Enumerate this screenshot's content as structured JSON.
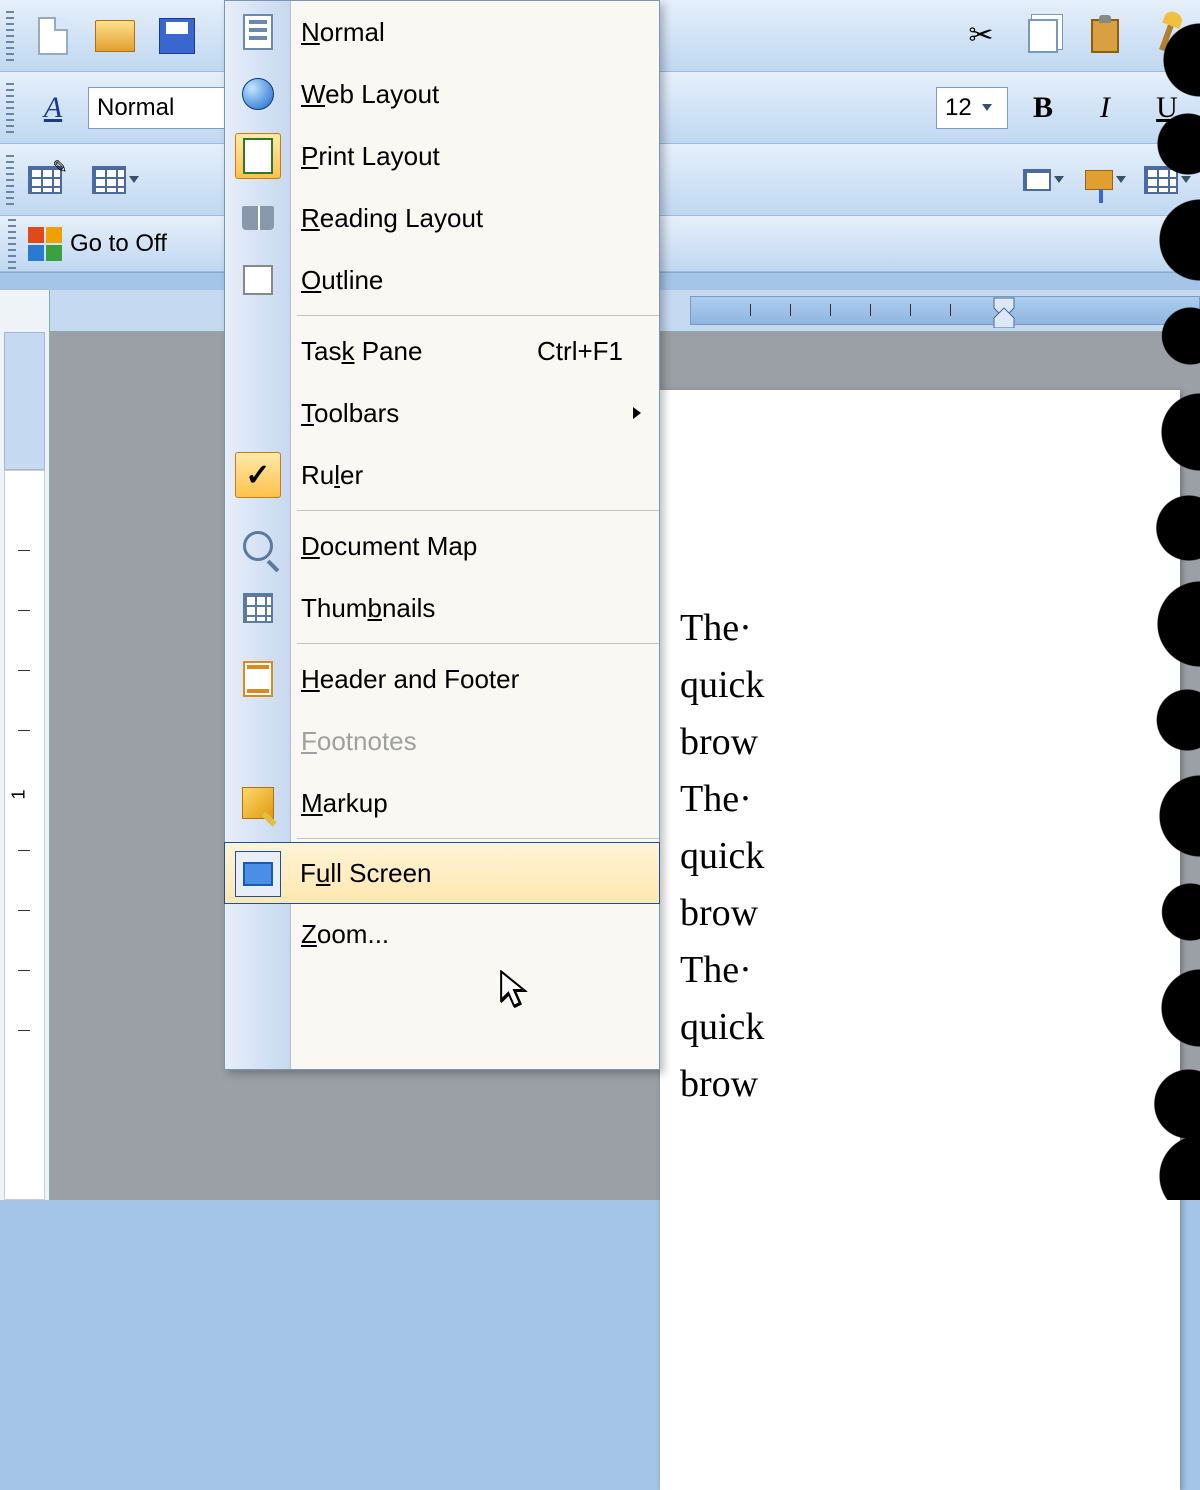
{
  "toolbar": {
    "style_combo": "Normal",
    "font_size": "12",
    "bold": "B",
    "italic": "I",
    "underline": "U",
    "office_link": "Go to Off"
  },
  "menu": {
    "normal": "Normal",
    "web_layout": "Web Layout",
    "print_layout": "Print Layout",
    "reading_layout": "Reading Layout",
    "outline": "Outline",
    "task_pane": "Task Pane",
    "task_pane_shortcut": "Ctrl+F1",
    "toolbars": "Toolbars",
    "ruler": "Ruler",
    "document_map": "Document Map",
    "thumbnails": "Thumbnails",
    "header_footer": "Header and Footer",
    "footnotes": "Footnotes",
    "markup": "Markup",
    "full_screen": "Full Screen",
    "zoom": "Zoom..."
  },
  "document": {
    "line1": "The·",
    "line2": "quick",
    "line3": "brow",
    "line4": "The·",
    "line5": "quick",
    "line6": "brow",
    "line7": "The·",
    "line8": "quick",
    "line9": "brow"
  },
  "ruler": {
    "num1": "1"
  }
}
